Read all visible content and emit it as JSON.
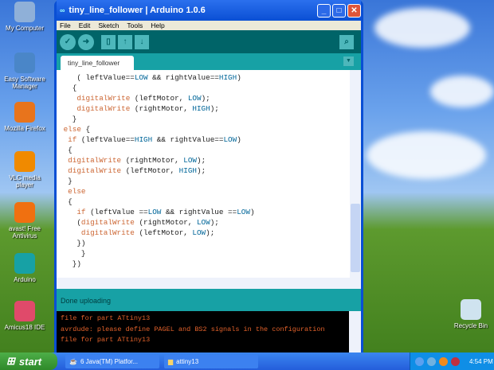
{
  "desktop": {
    "icons": [
      {
        "label": "My Computer",
        "color": "#8fb0d8"
      },
      {
        "label": "Easy Software Manager",
        "color": "#4a86c8"
      },
      {
        "label": "Mozilla Firefox",
        "color": "#e8741c"
      },
      {
        "label": "VLC media player",
        "color": "#f08a00"
      },
      {
        "label": "avast! Free Antivirus",
        "color": "#f07010"
      },
      {
        "label": "Arduino",
        "color": "#17a1a5"
      },
      {
        "label": "Amicus18 IDE",
        "color": "#e04a6a"
      }
    ],
    "recycle_bin": "Recycle Bin"
  },
  "window": {
    "title": "tiny_line_follower | Arduino 1.0.6",
    "logo": "∞",
    "menu": [
      "File",
      "Edit",
      "Sketch",
      "Tools",
      "Help"
    ],
    "tab": "tiny_line_follower",
    "code": [
      [
        [
          "t",
          "    ( leftValue=="
        ],
        [
          "c",
          "LOW"
        ],
        [
          "t",
          " && rightValue=="
        ],
        [
          "c",
          "HIGH"
        ],
        [
          "t",
          ")"
        ]
      ],
      [
        [
          "t",
          "   {"
        ]
      ],
      [
        [
          "t",
          "    "
        ],
        [
          "k",
          "digitalWrite"
        ],
        [
          "t",
          " (leftMotor, "
        ],
        [
          "c",
          "LOW"
        ],
        [
          "t",
          ");"
        ]
      ],
      [
        [
          "t",
          "    "
        ],
        [
          "k",
          "digitalWrite"
        ],
        [
          "t",
          " (rightMotor, "
        ],
        [
          "c",
          "HIGH"
        ],
        [
          "t",
          ");"
        ]
      ],
      [
        [
          "t",
          "   }"
        ]
      ],
      [
        [
          "k",
          " else"
        ],
        [
          "t",
          " {"
        ]
      ],
      [
        [
          "t",
          "  "
        ],
        [
          "k",
          "if"
        ],
        [
          "t",
          " (leftValue=="
        ],
        [
          "c",
          "HIGH"
        ],
        [
          "t",
          " && rightValue=="
        ],
        [
          "c",
          "LOW"
        ],
        [
          "t",
          ")"
        ]
      ],
      [
        [
          "t",
          "  {"
        ]
      ],
      [
        [
          "t",
          "  "
        ],
        [
          "k",
          "digitalWrite"
        ],
        [
          "t",
          " (rightMotor, "
        ],
        [
          "c",
          "LOW"
        ],
        [
          "t",
          ");"
        ]
      ],
      [
        [
          "t",
          "  "
        ],
        [
          "k",
          "digitalWrite"
        ],
        [
          "t",
          " (leftMotor, "
        ],
        [
          "c",
          "HIGH"
        ],
        [
          "t",
          ");"
        ]
      ],
      [
        [
          "t",
          "  }"
        ]
      ],
      [
        [
          "t",
          "  "
        ],
        [
          "k",
          "else"
        ]
      ],
      [
        [
          "t",
          "  {"
        ]
      ],
      [
        [
          "t",
          "    "
        ],
        [
          "k",
          "if"
        ],
        [
          "t",
          " (leftValue =="
        ],
        [
          "c",
          "LOW"
        ],
        [
          "t",
          " && rightValue =="
        ],
        [
          "c",
          "LOW"
        ],
        [
          "t",
          ")"
        ]
      ],
      [
        [
          "t",
          "    ("
        ],
        [
          "k",
          "digitalWrite"
        ],
        [
          "t",
          " (rightMotor, "
        ],
        [
          "c",
          "LOW"
        ],
        [
          "t",
          ");"
        ]
      ],
      [
        [
          "t",
          "     "
        ],
        [
          "k",
          "digitalWrite"
        ],
        [
          "t",
          " (leftMotor, "
        ],
        [
          "c",
          "LOW"
        ],
        [
          "t",
          ");"
        ]
      ],
      [
        [
          "t",
          "    })"
        ]
      ],
      [
        [
          "t",
          "     }"
        ]
      ],
      [
        [
          "t",
          "   })"
        ]
      ]
    ],
    "status": "Done uploading",
    "console": [
      "file for part ATtiny13",
      "avrdude: please define PAGEL and BS2 signals in the configuration",
      "file for part ATtiny13"
    ]
  },
  "taskbar": {
    "start": "start",
    "tasks": [
      "6 Java(TM) Platfor...",
      "attiny13"
    ],
    "clock": "4:54 PM"
  }
}
